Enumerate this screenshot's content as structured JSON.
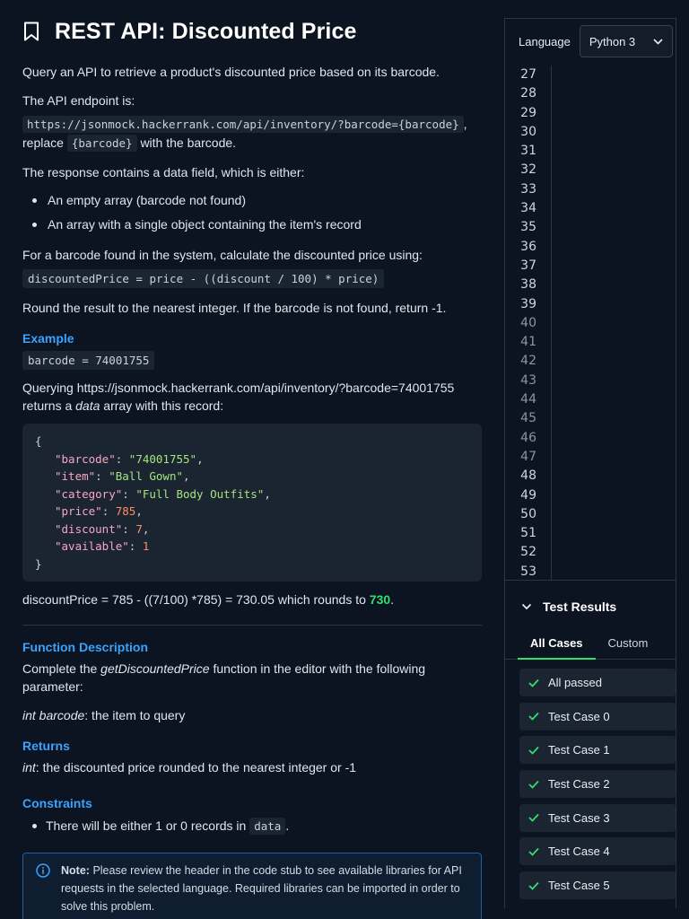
{
  "problem": {
    "title": "REST API: Discounted Price",
    "intro": "Query an API to retrieve a product's discounted price based on its barcode.",
    "endpoint_label": "The API endpoint is:",
    "endpoint_url": "https://jsonmock.hackerrank.com/api/inventory/?barcode={barcode}",
    "endpoint_comma": ",",
    "replace_pre": "replace",
    "replace_code": "{barcode}",
    "replace_post": "with the barcode.",
    "response_intro": "The response contains a data field, which is either:",
    "response_items": [
      "An empty array (barcode not found)",
      "An array with a single object containing the item's record"
    ],
    "formula_intro": "For a barcode found in the system, calculate the discounted price using:",
    "formula": "discountedPrice = price - ((discount / 100) * price)",
    "round_text": "Round the result to the nearest integer. If the barcode is not found, return -1.",
    "example_heading": "Example",
    "example_code": "barcode = 74001755",
    "query_text": "Querying https://jsonmock.hackerrank.com/api/inventory/?barcode=74001755",
    "returns_pre": "returns a",
    "returns_em": "data",
    "returns_post": "array with this record:",
    "json": {
      "open": "{",
      "close": "}",
      "lines": [
        {
          "key": "\"barcode\"",
          "value": "\"74001755\"",
          "vtype": "s",
          "comma": ","
        },
        {
          "key": "\"item\"",
          "value": "\"Ball Gown\"",
          "vtype": "s",
          "comma": ","
        },
        {
          "key": "\"category\"",
          "value": "\"Full Body Outfits\"",
          "vtype": "s",
          "comma": ","
        },
        {
          "key": "\"price\"",
          "value": "785",
          "vtype": "n",
          "comma": ","
        },
        {
          "key": "\"discount\"",
          "value": "7",
          "vtype": "n",
          "comma": ","
        },
        {
          "key": "\"available\"",
          "value": "1",
          "vtype": "n",
          "comma": ""
        }
      ]
    },
    "calc_text": "discountPrice = 785 - ((7/100) *785) = 730.05 which rounds to",
    "calc_result": "730",
    "calc_period": ".",
    "func_heading": "Function Description",
    "func_pre": "Complete the",
    "func_em": "getDiscountedPrice",
    "func_post": "function in the editor with the following parameter:",
    "param_em": "int barcode",
    "param_post": ": the item to query",
    "returns_heading": "Returns",
    "returns_type": "int",
    "returns_desc": ": the discounted price rounded to the nearest integer or -1",
    "constraints_heading": "Constraints",
    "constraint_pre": "There will be either 1 or 0 records in",
    "constraint_code": "data",
    "constraint_post": ".",
    "note_label": "Note:",
    "note_text": "Please review the header in the code stub to see available libraries for API requests in the selected language. Required libraries can be imported in order to solve this problem."
  },
  "editor": {
    "language_label": "Language",
    "language_value": "Python 3",
    "line_numbers": [
      "27",
      "28",
      "29",
      "30",
      "31",
      "32",
      "33",
      "34",
      "35",
      "36",
      "37",
      "38",
      "39",
      "40",
      "41",
      "42",
      "43",
      "44",
      "45",
      "46",
      "47",
      "48",
      "49",
      "50",
      "51",
      "52",
      "53"
    ]
  },
  "tests": {
    "title": "Test Results",
    "tabs": [
      "All Cases",
      "Custom"
    ],
    "cases": [
      "All passed",
      "Test Case 0",
      "Test Case 1",
      "Test Case 2",
      "Test Case 3",
      "Test Case 4",
      "Test Case 5"
    ]
  },
  "colors": {
    "accent_blue": "#39a3ff",
    "success_green": "#2ee06f",
    "background": "#0b1420"
  }
}
